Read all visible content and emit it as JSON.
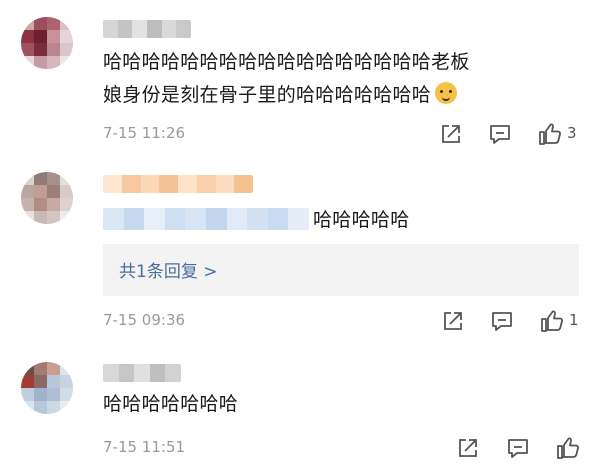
{
  "comments": [
    {
      "text_line1": "哈哈哈哈哈哈哈哈哈哈哈哈哈哈哈哈哈老板",
      "text_line2": "娘身份是刻在骨子里的哈哈哈哈哈哈哈",
      "emoji": "doge-icon",
      "time": "7-15 11:26",
      "likes": "3"
    },
    {
      "text": "哈哈哈哈哈",
      "time": "7-15 09:36",
      "likes": "1",
      "reply_label": "共1条回复 >"
    },
    {
      "text": "哈哈哈哈哈哈哈",
      "time": "7-15 11:51",
      "likes": ""
    }
  ],
  "icons": [
    "share-icon",
    "comment-icon",
    "like-icon"
  ],
  "colors": {
    "time": "#9a9a9a",
    "link": "#4b6d9b",
    "reply_bg": "#f3f3f3"
  }
}
